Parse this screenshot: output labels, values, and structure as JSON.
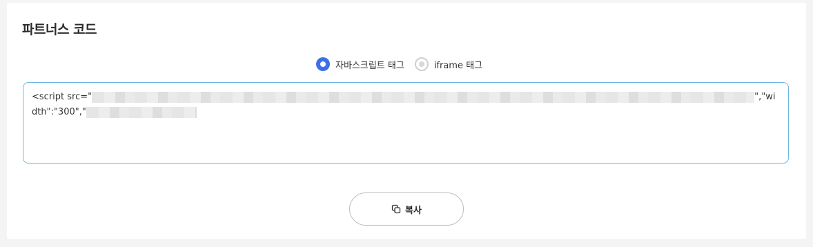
{
  "section": {
    "title": "파트너스 코드"
  },
  "tag_options": [
    {
      "label": "자바스크립트 태그",
      "selected": true
    },
    {
      "label": "iframe 태그",
      "selected": false
    }
  ],
  "code": {
    "line1_prefix": "<script src=\"",
    "line1_suffix": "\",\"wi",
    "line2_prefix": "dth\":\"300\",\""
  },
  "actions": {
    "copy_label": "복사",
    "copy_icon": "copy-icon"
  },
  "colors": {
    "accent": "#3c6fe8",
    "box_border": "#6bb6e3"
  }
}
